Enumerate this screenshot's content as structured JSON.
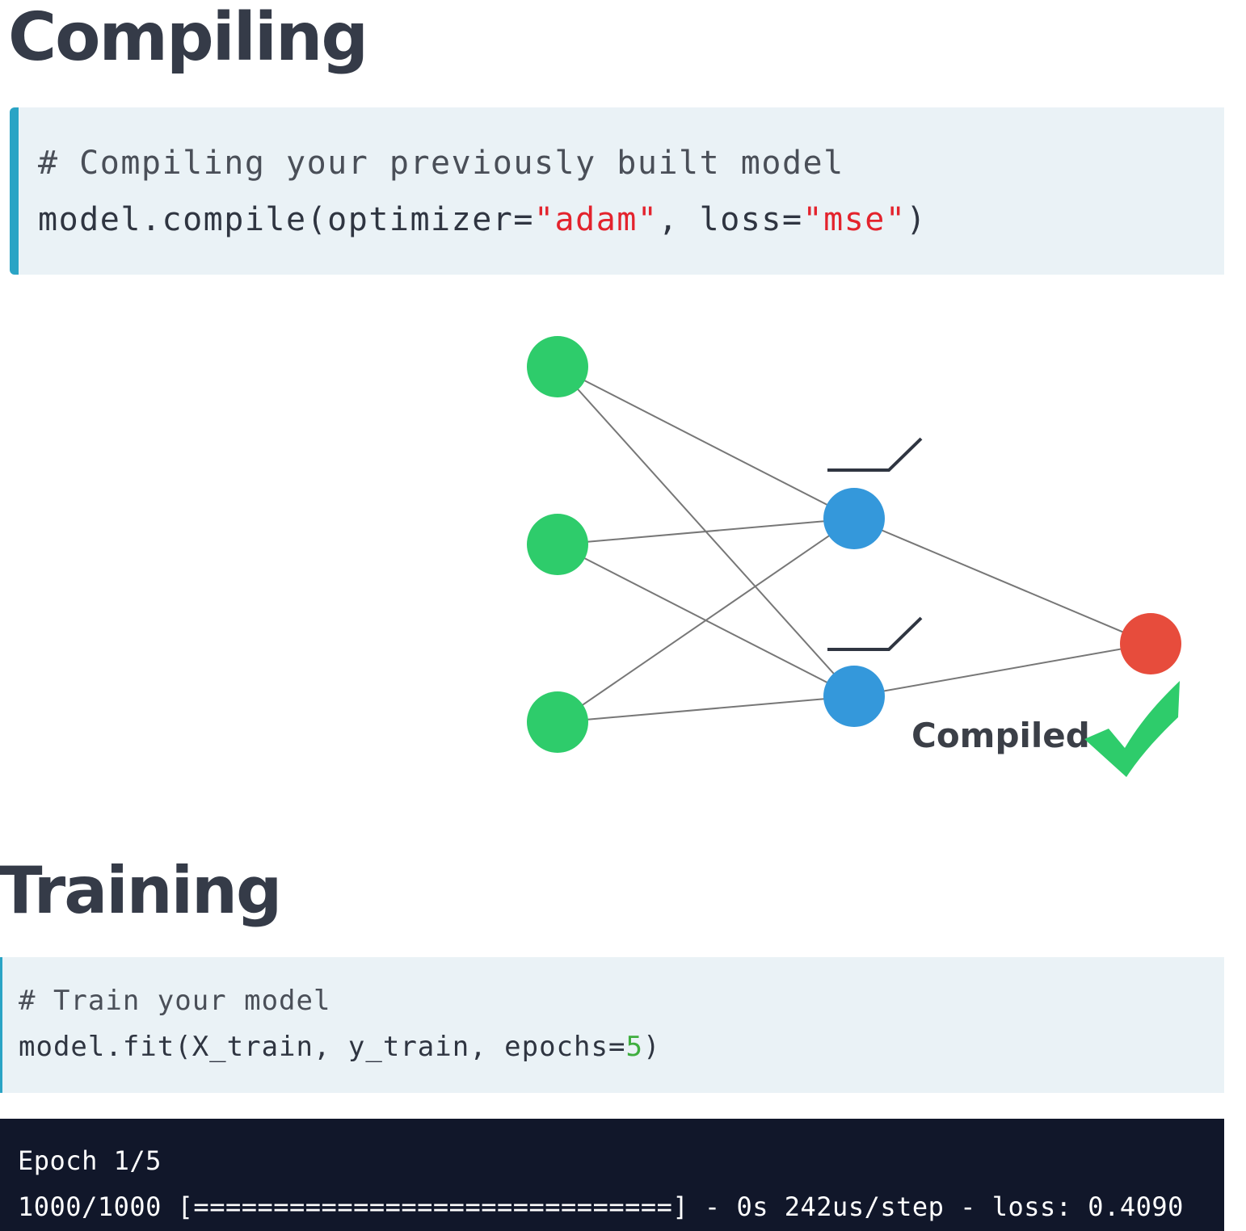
{
  "sections": {
    "compiling_title": "Compiling",
    "training_title": "Training"
  },
  "compile_code": {
    "comment": "# Compiling your previously built model",
    "line2_prefix": "model.compile(optimizer=",
    "optimizer_value": "\"adam\"",
    "line2_middle": ", loss=",
    "loss_value": "\"mse\"",
    "line2_suffix": ")"
  },
  "train_code": {
    "comment": "# Train your model",
    "line2_prefix": "model.fit(X_train, y_train, epochs=",
    "epochs_value": "5",
    "line2_suffix": ")"
  },
  "terminal": {
    "epoch_line": "Epoch 1/5",
    "progress_line": "1000/1000 [==============================] - 0s 242us/step - loss: 0.4090"
  },
  "diagram": {
    "status_label": "Compiled",
    "check_icon": "checkmark-icon",
    "colors": {
      "input_node": "#2ecc6b",
      "hidden_node": "#3498db",
      "output_node": "#e74c3c",
      "check": "#2ecc6b",
      "edge": "#777777"
    }
  }
}
